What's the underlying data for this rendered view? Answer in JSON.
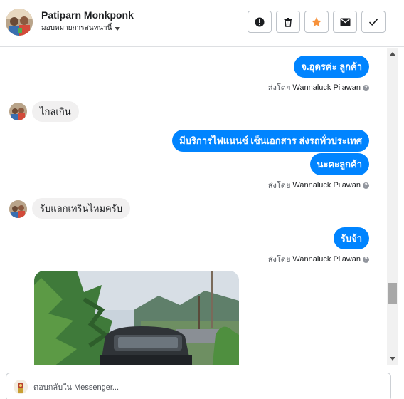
{
  "header": {
    "contact_name": "Patiparn Monkponk",
    "assign_label": "มอบหมายการสนทนานี้",
    "actions": [
      {
        "icon": "alert-icon",
        "tooltip": ""
      },
      {
        "icon": "trash-icon",
        "tooltip": ""
      },
      {
        "icon": "star-icon",
        "tooltip": ""
      },
      {
        "icon": "envelope-icon",
        "tooltip": ""
      },
      {
        "icon": "check-icon",
        "tooltip": ""
      }
    ]
  },
  "messages": {
    "m1": "จ.อุดรค่ะ ลูกค้า",
    "m2": "ไกลเกิน",
    "m3": "มีบริการไฟแนนซ์ เซ็นเอกสาร ส่งรถทั่วประเทศ",
    "m4": "นะคะลูกค้า",
    "m5": "รับแลกเทรินไหมครับ",
    "m6": "รับจ้า",
    "sent_by_prefix": "ส่งโดย",
    "sender": "Wannaluck Pilawan"
  },
  "reply": {
    "placeholder": "ตอบกลับใน Messenger..."
  },
  "colors": {
    "outgoing_bubble": "#0084ff",
    "incoming_bubble": "#f1f0f0",
    "star": "#f7923b"
  }
}
